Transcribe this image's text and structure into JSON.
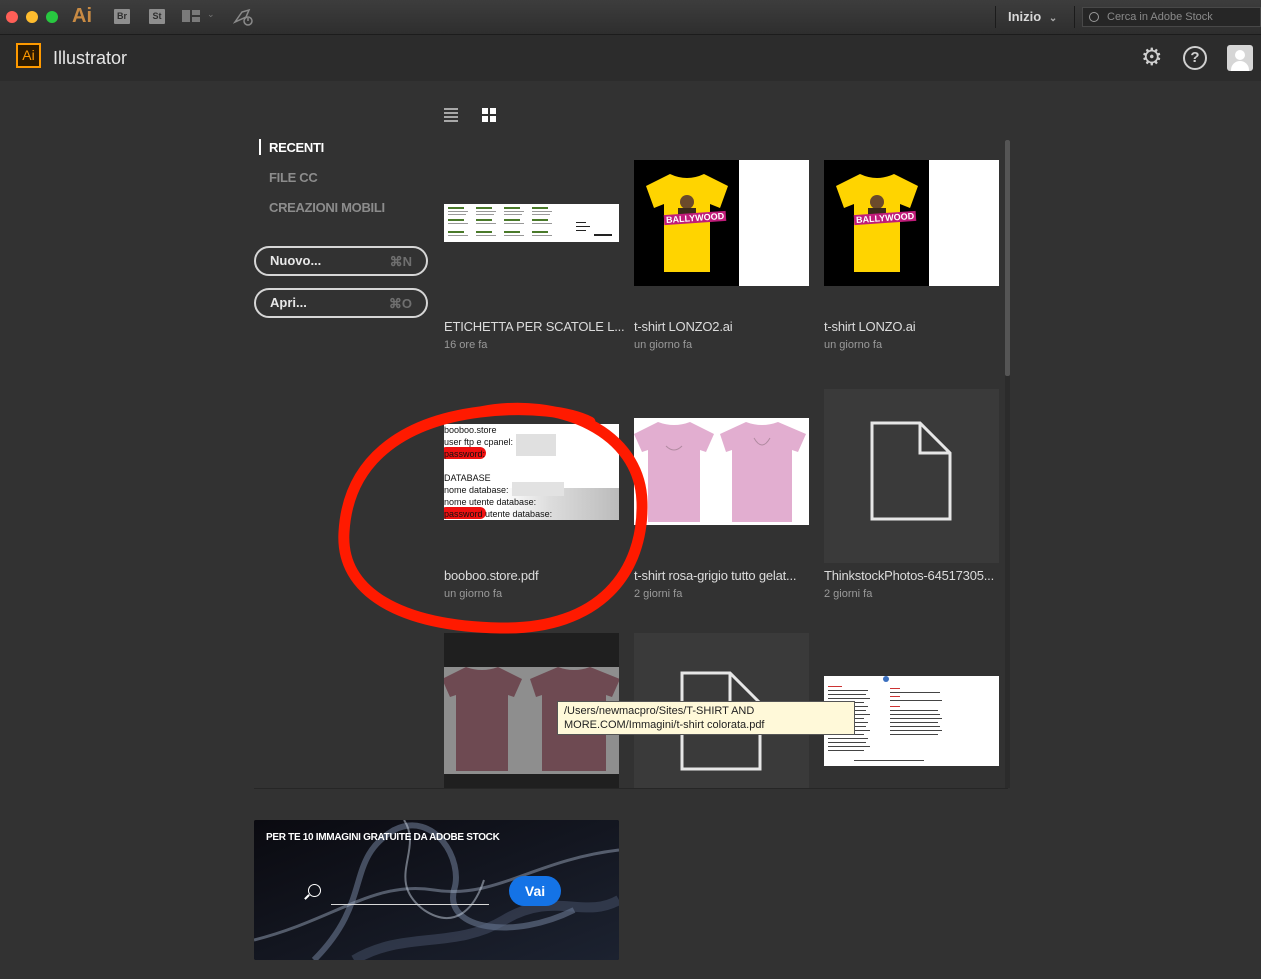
{
  "window": {
    "menu_app_glyph": "Ai",
    "toolbar_icons": [
      "Br",
      "St"
    ],
    "workspace": "Inizio",
    "search_placeholder": "Cerca in Adobe Stock"
  },
  "app": {
    "logo": "Ai",
    "name": "Illustrator"
  },
  "nav": {
    "items": [
      {
        "label": "RECENTI",
        "active": true
      },
      {
        "label": "FILE CC",
        "active": false
      },
      {
        "label": "CREAZIONI MOBILI",
        "active": false
      }
    ]
  },
  "buttons": {
    "new": {
      "label": "Nuovo...",
      "shortcut": "⌘N"
    },
    "open": {
      "label": "Apri...",
      "shortcut": "⌘O"
    }
  },
  "files": [
    {
      "name": "ETICHETTA PER SCATOLE L...",
      "time": "16 ore fa"
    },
    {
      "name": "t-shirt LONZO2.ai",
      "time": "un giorno fa"
    },
    {
      "name": "t-shirt LONZO.ai",
      "time": "un giorno fa"
    },
    {
      "name": "booboo.store.pdf",
      "time": "un giorno fa"
    },
    {
      "name": "t-shirt rosa-grigio tutto gelat...",
      "time": "2 giorni fa"
    },
    {
      "name": "ThinkstockPhotos-64517305...",
      "time": "2 giorni fa"
    },
    {
      "name": "",
      "time": ""
    },
    {
      "name": "",
      "time": ""
    },
    {
      "name": "",
      "time": ""
    }
  ],
  "doc_preview": {
    "lines": [
      "booboo.store",
      "user ftp e cpanel:",
      "password:",
      "",
      "DATABASE",
      "nome database:",
      "nome utente database:",
      "password utente database:"
    ]
  },
  "tshirt_print": "BALLYWOOD",
  "tooltip": {
    "line1": "/Users/newmacpro/Sites/T-SHIRT AND",
    "line2": "MORE.COM/Immagini/t-shirt colorata.pdf"
  },
  "stock": {
    "title": "PER TE 10 IMMAGINI GRATUITE DA ADOBE STOCK",
    "button": "Vai"
  },
  "colors": {
    "accent": "#1473e6",
    "annotation": "#ff1a00",
    "logo": "#ff9a00"
  }
}
